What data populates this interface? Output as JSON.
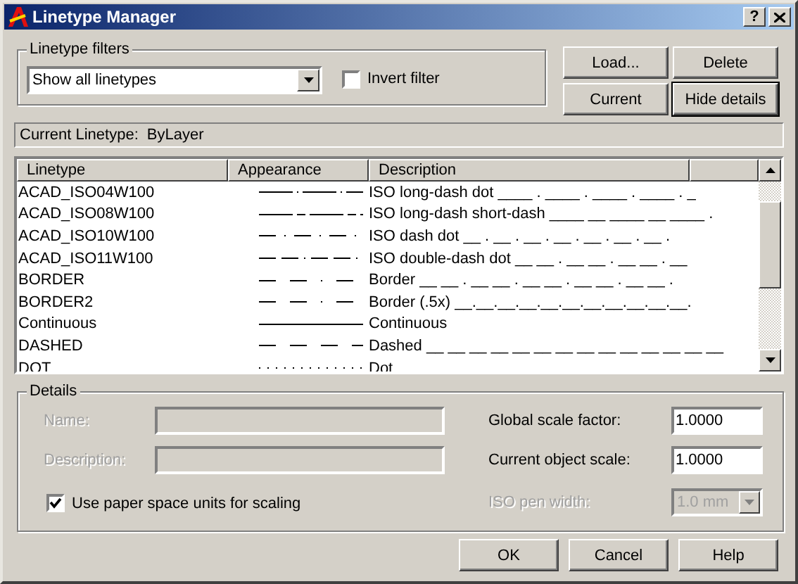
{
  "window": {
    "title": "Linetype Manager",
    "help_button": "?"
  },
  "filters": {
    "label": "Linetype filters",
    "dropdown": {
      "value": "Show all linetypes"
    },
    "invert": {
      "label": "Invert filter",
      "checked": false
    }
  },
  "buttons": [
    {
      "label": "Load...",
      "focused": false
    },
    {
      "label": "Delete",
      "focused": false
    },
    {
      "label": "Current",
      "focused": false
    },
    {
      "label": "Hide details",
      "focused": true
    }
  ],
  "current_linetype": {
    "label": "Current Linetype:",
    "value": "ByLayer"
  },
  "table": {
    "columns": [
      "Linetype",
      "Appearance",
      "Description"
    ],
    "rows": [
      {
        "linetype": "ACAD_ISO04W100",
        "kind": "long-dash-dot",
        "description": "ISO long-dash dot ____ . ____ . ____ . ____ . _"
      },
      {
        "linetype": "ACAD_ISO08W100",
        "kind": "long-dash-short-dash",
        "description": "ISO long-dash short-dash ____ __ ____ __ ____ ."
      },
      {
        "linetype": "ACAD_ISO10W100",
        "kind": "dash-dot",
        "description": "ISO dash dot __ . __ . __ . __ . __ . __ . __ ."
      },
      {
        "linetype": "ACAD_ISO11W100",
        "kind": "double-dash-dot",
        "description": "ISO double-dash dot __ __ . __ __ . __ __ . __"
      },
      {
        "linetype": "BORDER",
        "kind": "border",
        "description": "Border __ __ . __ __ . __ __ . __ __ . __ __ ."
      },
      {
        "linetype": "BORDER2",
        "kind": "border",
        "description": "Border (.5x) __.__.__.__.__.__.__.__.__.__.__."
      },
      {
        "linetype": "Continuous",
        "kind": "continuous",
        "description": "Continuous"
      },
      {
        "linetype": "DASHED",
        "kind": "dashed",
        "description": "Dashed __ __ __ __ __ __ __ __ __ __ __ __ __ __"
      },
      {
        "linetype": "DOT",
        "kind": "dot",
        "description": "Dot"
      }
    ]
  },
  "details": {
    "title": "Details",
    "name": {
      "label": "Name:",
      "disabled": true
    },
    "description": {
      "label": "Description:",
      "disabled": true
    },
    "paper_space": {
      "label": "Use paper space units for scaling",
      "checked": true
    },
    "global_scale": {
      "label": "Global scale factor:",
      "value": "1.0000"
    },
    "object_scale": {
      "label": "Current object scale:",
      "value": "1.0000"
    },
    "pen_width": {
      "label": "ISO pen width:",
      "value": "1.0 mm",
      "disabled": true
    }
  },
  "footer_buttons": [
    "OK",
    "Cancel",
    "Help"
  ]
}
